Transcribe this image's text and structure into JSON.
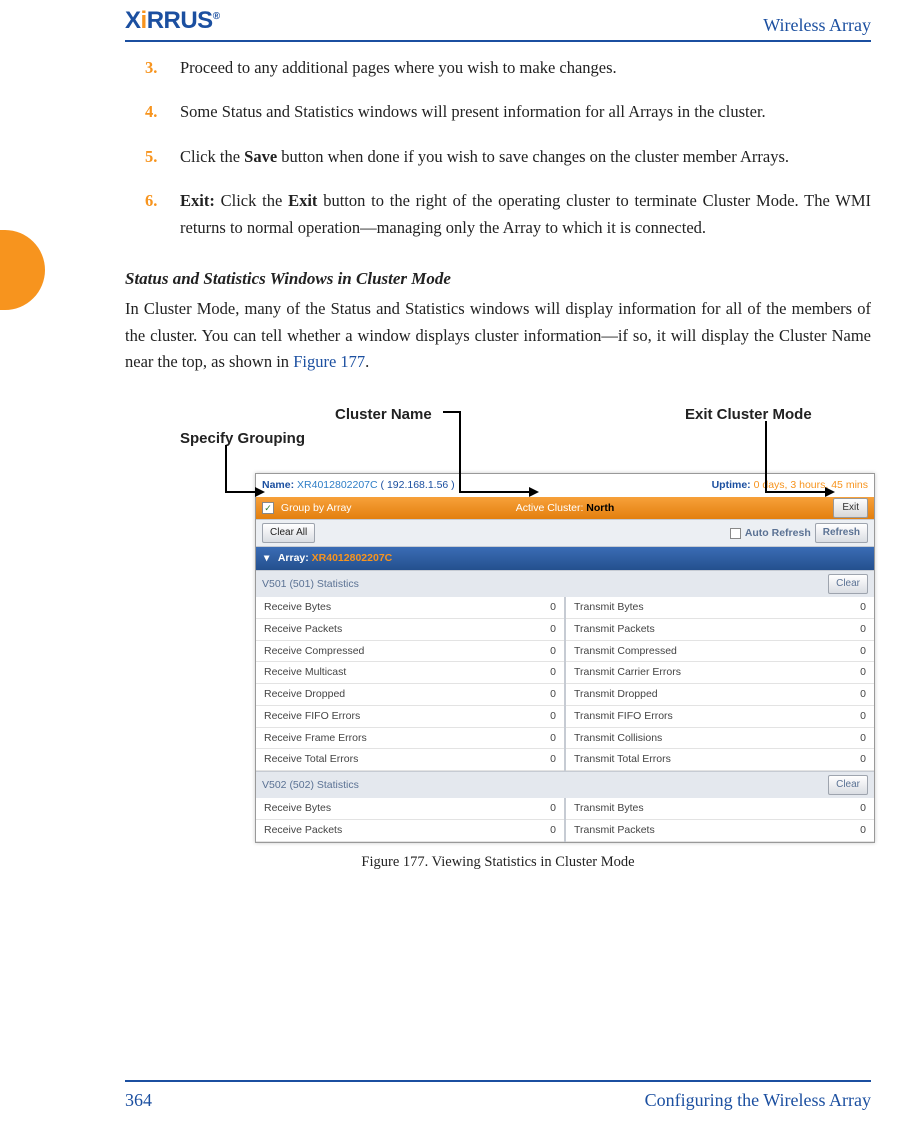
{
  "header": {
    "logo_text": "XIRRUS",
    "doc_title": "Wireless Array"
  },
  "steps": [
    {
      "num": "3.",
      "text": "Proceed to any additional pages where you wish to make changes."
    },
    {
      "num": "4.",
      "text": "Some Status and Statistics windows will present information for all Arrays in the cluster."
    },
    {
      "num": "5.",
      "prefix": "Click the ",
      "bold1": "Save",
      "suffix": " button when done if you wish to save changes on the cluster member Arrays."
    },
    {
      "num": "6.",
      "bold1": "Exit:",
      "mid1": " Click the ",
      "bold2": "Exit",
      "suffix": " button to the right of the operating cluster to terminate Cluster Mode. The WMI returns to normal operation—managing only the Array to which it is connected."
    }
  ],
  "subhead": "Status and Statistics Windows in Cluster Mode",
  "para": {
    "t1": "In Cluster Mode, many of the Status and Statistics windows will display information for all of the members of the cluster. You can tell whether a window displays cluster information—if so, it will display the Cluster Name near the top, as shown in ",
    "link": "Figure 177",
    "t2": "."
  },
  "callouts": {
    "cluster_name": "Cluster Name",
    "exit_cluster": "Exit Cluster Mode",
    "specify_grouping": "Specify Grouping"
  },
  "ui": {
    "name_label": "Name:",
    "name_val": "XR4012802207C",
    "name_ip": "( 192.168.1.56 )",
    "uptime_label": "Uptime:",
    "uptime_val": "0 days, 3 hours, 45 mins",
    "group_by": "Group by Array",
    "active_cluster_label": "Active Cluster:",
    "active_cluster_val": "North",
    "exit_btn": "Exit",
    "clear_all": "Clear All",
    "auto_refresh": "Auto Refresh",
    "refresh": "Refresh",
    "array_label": "Array:",
    "array_val": "XR4012802207C",
    "sec1": "V501 (501) Statistics",
    "sec2": "V502 (502) Statistics",
    "clear": "Clear",
    "left1": [
      {
        "k": "Receive Bytes",
        "v": "0"
      },
      {
        "k": "Receive Packets",
        "v": "0"
      },
      {
        "k": "Receive Compressed",
        "v": "0"
      },
      {
        "k": "Receive Multicast",
        "v": "0"
      },
      {
        "k": "Receive Dropped",
        "v": "0"
      },
      {
        "k": "Receive FIFO Errors",
        "v": "0"
      },
      {
        "k": "Receive Frame Errors",
        "v": "0"
      },
      {
        "k": "Receive Total Errors",
        "v": "0"
      }
    ],
    "right1": [
      {
        "k": "Transmit Bytes",
        "v": "0"
      },
      {
        "k": "Transmit Packets",
        "v": "0"
      },
      {
        "k": "Transmit Compressed",
        "v": "0"
      },
      {
        "k": "Transmit Carrier Errors",
        "v": "0"
      },
      {
        "k": "Transmit Dropped",
        "v": "0"
      },
      {
        "k": "Transmit FIFO Errors",
        "v": "0"
      },
      {
        "k": "Transmit Collisions",
        "v": "0"
      },
      {
        "k": "Transmit Total Errors",
        "v": "0"
      }
    ],
    "left2": [
      {
        "k": "Receive Bytes",
        "v": "0"
      },
      {
        "k": "Receive Packets",
        "v": "0"
      }
    ],
    "right2": [
      {
        "k": "Transmit Bytes",
        "v": "0"
      },
      {
        "k": "Transmit Packets",
        "v": "0"
      }
    ]
  },
  "figure_caption": "Figure 177. Viewing Statistics in Cluster Mode",
  "footer": {
    "page": "364",
    "chapter": "Configuring the Wireless Array"
  }
}
